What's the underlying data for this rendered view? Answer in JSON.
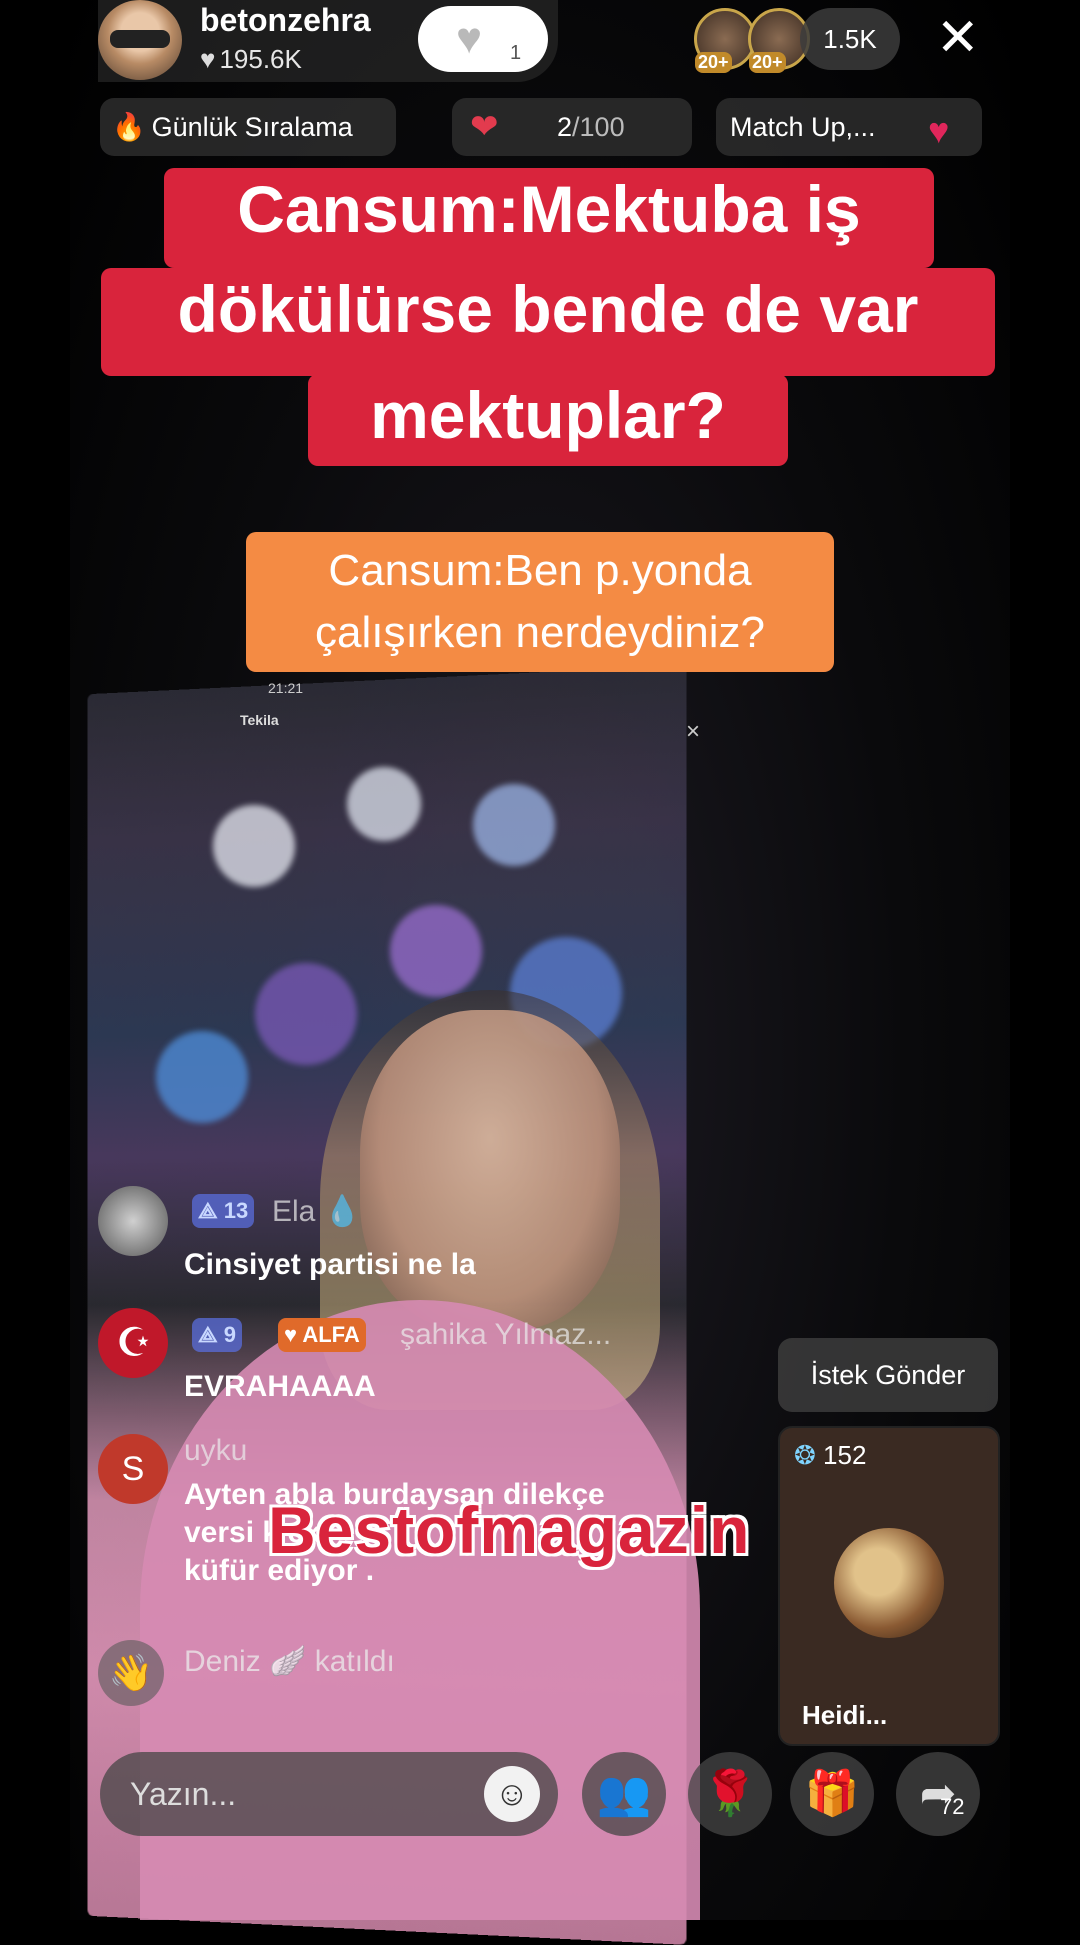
{
  "host": {
    "name": "betonzehra",
    "likes": "195.6K",
    "follow_count": "1"
  },
  "viewers": {
    "badges": [
      "20+",
      "20+"
    ],
    "count": "1.5K"
  },
  "chips": {
    "ranking": "Günlük Sıralama",
    "progress": "2",
    "progress_total": "/100",
    "match": "Match Up,..."
  },
  "captions": {
    "red": [
      "Cansum:Mektuba iş",
      "dökülürse bende de var",
      "mektuplar?"
    ],
    "orange": [
      "Cansum:Ben p.yonda",
      "çalışırken nerdeydiniz?"
    ]
  },
  "inner_frame": {
    "time": "21:21",
    "host": "Tekila"
  },
  "comments": [
    {
      "level": "13",
      "name": "Ela 💧",
      "text": "Cinsiyet partisi ne la"
    },
    {
      "level": "9",
      "badge": "ALFA",
      "name": "şahika Yılmaz...",
      "text": "EVRAHAAAA"
    },
    {
      "initial": "S",
      "name": "uyku",
      "text_lines": [
        "Ayten abla burdaysan  dilekçe",
        "versi          k       ek",
        "küfür ediyor  ."
      ]
    }
  ],
  "join": {
    "name": "Deniz",
    "text": "katıldı"
  },
  "request_button": "İstek Gönder",
  "guest_card": {
    "count": "152",
    "name": "Heidi..."
  },
  "watermark": "Bestofmagazin",
  "input": {
    "placeholder": "Yazın..."
  },
  "share_count": "72",
  "icons": {
    "close": "close-icon",
    "heart": "heart-icon",
    "fire": "fire-icon",
    "gift": "gift-icon",
    "rose": "rose-icon",
    "share": "share-icon",
    "emoji": "emoji-icon",
    "multiguest": "multiguest-icon",
    "wave": "wave-icon"
  },
  "colors": {
    "caption_red": "#d9243c",
    "caption_orange": "#f48b44"
  }
}
